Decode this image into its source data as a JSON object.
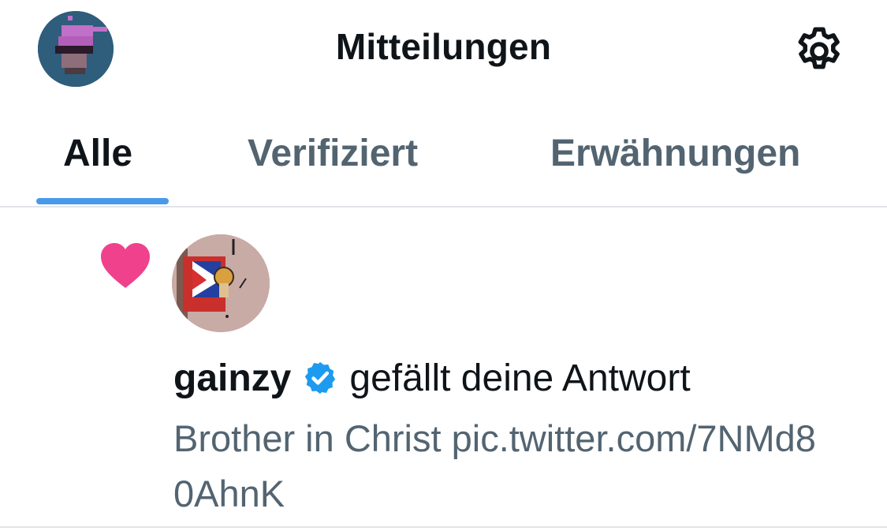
{
  "header": {
    "title": "Mitteilungen",
    "profile_icon": "profile-avatar-icon",
    "settings_icon": "gear-icon"
  },
  "tabs": [
    {
      "label": "Alle",
      "active": true
    },
    {
      "label": "Verifiziert",
      "active": false
    },
    {
      "label": "Erwähnungen",
      "active": false
    }
  ],
  "notification": {
    "type_icon": "heart-icon",
    "username": "gainzy",
    "verified": true,
    "action": "gefällt deine Antwort",
    "preview": "Brother in Christ pic.twitter.com/7NMd80AhnK"
  },
  "colors": {
    "accent": "#4a99e9",
    "like": "#f0418c",
    "verified": "#1d9bf0",
    "secondary_text": "#536471"
  }
}
